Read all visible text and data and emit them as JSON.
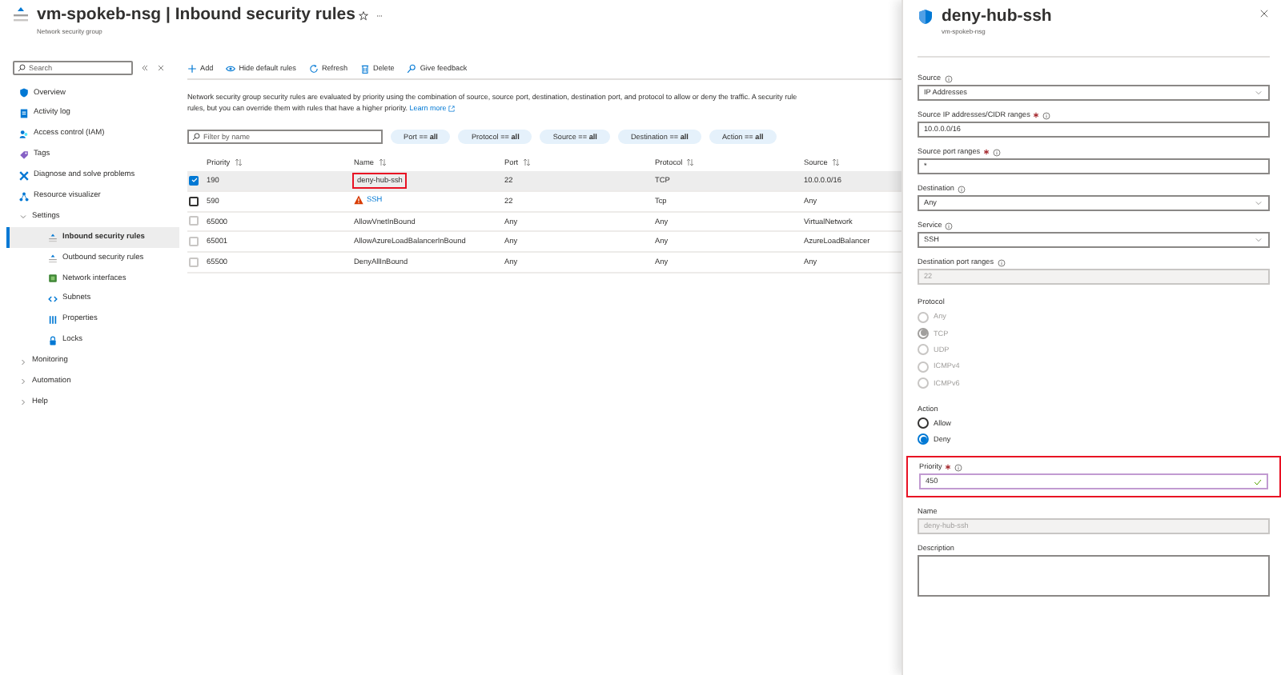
{
  "header": {
    "title": "vm-spokeb-nsg | Inbound security rules",
    "subtitle": "Network security group"
  },
  "sidebar": {
    "search_placeholder": "Search",
    "items": [
      {
        "label": "Overview",
        "selected": false
      },
      {
        "label": "Activity log",
        "selected": false
      },
      {
        "label": "Access control (IAM)",
        "selected": false
      },
      {
        "label": "Tags",
        "selected": false
      },
      {
        "label": "Diagnose and solve problems",
        "selected": false
      },
      {
        "label": "Resource visualizer",
        "selected": false
      },
      {
        "label": "Settings",
        "expanded": true,
        "selected": false,
        "children": [
          {
            "label": "Inbound security rules",
            "selected": true
          },
          {
            "label": "Outbound security rules",
            "selected": false
          },
          {
            "label": "Network interfaces",
            "selected": false
          },
          {
            "label": "Subnets",
            "selected": false
          },
          {
            "label": "Properties",
            "selected": false
          },
          {
            "label": "Locks",
            "selected": false
          }
        ]
      },
      {
        "label": "Monitoring",
        "expanded": false,
        "selected": false
      },
      {
        "label": "Automation",
        "expanded": false,
        "selected": false
      },
      {
        "label": "Help",
        "expanded": false,
        "selected": false
      }
    ]
  },
  "toolbar": [
    "Add",
    "Hide default rules",
    "Refresh",
    "Delete",
    "Give feedback"
  ],
  "description": {
    "line_1": "Network security group security rules are evaluated by priority using the combination of source, source port, destination, destination port, and protocol to allow or deny the traffic. A security rule",
    "line_2": "rules, but you can override them with rules that have a higher priority.",
    "link": "Learn more"
  },
  "filter": {
    "placeholder": "Filter by name",
    "pills": [
      "Port == **all**",
      "Protocol == **all**",
      "Source == **all**",
      "Destination == **all**",
      "Action == **all**"
    ]
  },
  "table": {
    "columns": [
      "Priority",
      "Name",
      "Port",
      "Protocol",
      "Source"
    ],
    "rows": [
      {
        "checked": true,
        "selected": true,
        "disabled": false,
        "priority": "190",
        "name": "deny-hub-ssh",
        "outlined": true,
        "warning": false,
        "link": false,
        "port": "22",
        "protocol": "TCP",
        "source": "10.0.0.0/16"
      },
      {
        "checked": false,
        "selected": false,
        "disabled": false,
        "priority": "590",
        "name": "SSH",
        "outlined": false,
        "warning": true,
        "link": true,
        "port": "22",
        "protocol": "Tcp",
        "source": "Any"
      },
      {
        "checked": false,
        "selected": false,
        "disabled": true,
        "priority": "65000",
        "name": "AllowVnetInBound",
        "outlined": false,
        "warning": false,
        "link": false,
        "port": "Any",
        "protocol": "Any",
        "source": "VirtualNetwork"
      },
      {
        "checked": false,
        "selected": false,
        "disabled": true,
        "priority": "65001",
        "name": "AllowAzureLoadBalancerInBound",
        "outlined": false,
        "warning": false,
        "link": false,
        "port": "Any",
        "protocol": "Any",
        "source": "AzureLoadBalancer"
      },
      {
        "checked": false,
        "selected": false,
        "disabled": true,
        "priority": "65500",
        "name": "DenyAllInBound",
        "outlined": false,
        "warning": false,
        "link": false,
        "port": "Any",
        "protocol": "Any",
        "source": "Any"
      }
    ]
  },
  "panel": {
    "title": "deny-hub-ssh",
    "subtitle": "vm-spokeb-nsg",
    "fields": [
      {
        "kind": "select",
        "label": "Source",
        "info": true,
        "value": "IP Addresses"
      },
      {
        "kind": "text",
        "label": "Source IP addresses/CIDR ranges",
        "required": true,
        "info": true,
        "value": "10.0.0.0/16"
      },
      {
        "kind": "text",
        "label": "Source port ranges",
        "required": true,
        "info": true,
        "value": "*"
      },
      {
        "kind": "select",
        "label": "Destination",
        "info": true,
        "value": "Any"
      },
      {
        "kind": "select",
        "label": "Service",
        "info": true,
        "value": "SSH"
      },
      {
        "kind": "text",
        "label": "Destination port ranges",
        "info": true,
        "disabled": true,
        "value": "22"
      },
      {
        "kind": "radio",
        "label": "Protocol",
        "disabled": true,
        "options": [
          {
            "label": "Any",
            "selected": false
          },
          {
            "label": "TCP",
            "selected": true
          },
          {
            "label": "UDP",
            "selected": false
          },
          {
            "label": "ICMPv4",
            "selected": false
          },
          {
            "label": "ICMPv6",
            "selected": false
          }
        ]
      },
      {
        "kind": "radio",
        "label": "Action",
        "disabled": false,
        "options": [
          {
            "label": "Allow",
            "selected": false
          },
          {
            "label": "Deny",
            "selected": true
          }
        ]
      },
      {
        "kind": "text",
        "label": "Priority",
        "required": true,
        "info": true,
        "valid": true,
        "outlined": true,
        "value": "450"
      },
      {
        "kind": "text",
        "label": "Name",
        "disabled": true,
        "value": "deny-hub-ssh"
      },
      {
        "kind": "textarea",
        "label": "Description"
      }
    ]
  }
}
